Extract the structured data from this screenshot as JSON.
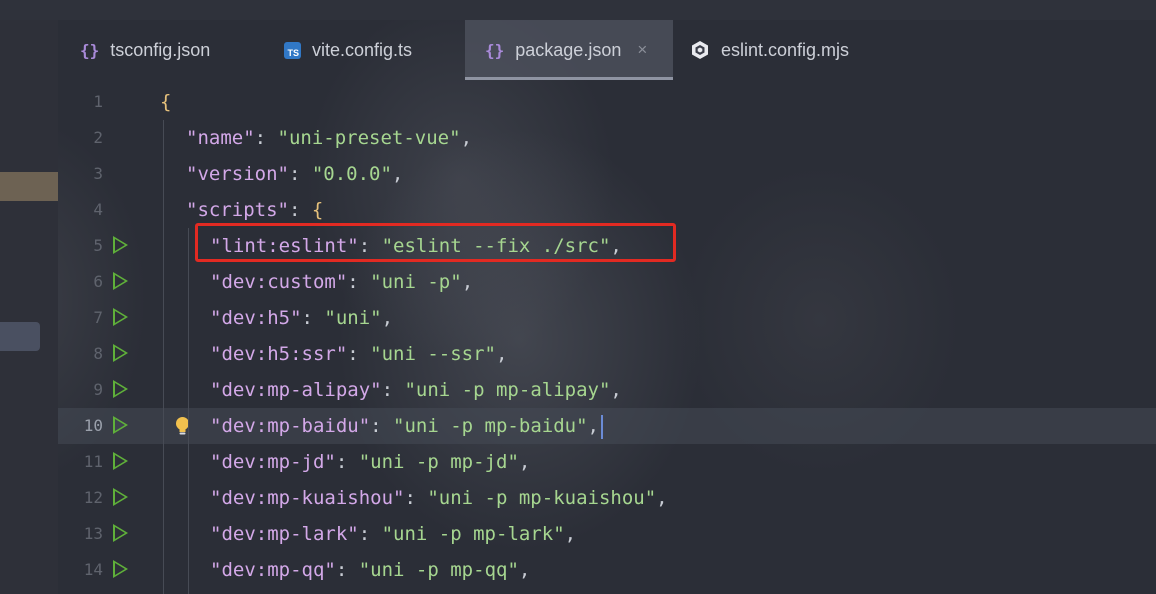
{
  "tabs": [
    {
      "label": "tsconfig.json",
      "icon": "json-brace-icon",
      "active": false
    },
    {
      "label": "vite.config.ts",
      "icon": "typescript-icon",
      "icon_text": "TS",
      "active": false
    },
    {
      "label": "package.json",
      "icon": "json-brace-icon",
      "active": true,
      "close": "×"
    },
    {
      "label": "eslint.config.mjs",
      "icon": "eslint-icon",
      "active": false
    }
  ],
  "editor": {
    "current_line": 10,
    "lines": [
      {
        "n": "1",
        "brace": "{"
      },
      {
        "n": "2",
        "key": "\"name\"",
        "value": "\"uni-preset-vue\"",
        "tail": ","
      },
      {
        "n": "3",
        "key": "\"version\"",
        "value": "\"0.0.0\"",
        "tail": ","
      },
      {
        "n": "4",
        "key": "\"scripts\"",
        "brace": "{"
      },
      {
        "n": "5",
        "key": "\"lint:eslint\"",
        "value": "\"eslint --fix ./src\"",
        "tail": ",",
        "run": true,
        "highlighted": true
      },
      {
        "n": "6",
        "key": "\"dev:custom\"",
        "value": "\"uni -p\"",
        "tail": ",",
        "run": true
      },
      {
        "n": "7",
        "key": "\"dev:h5\"",
        "value": "\"uni\"",
        "tail": ",",
        "run": true
      },
      {
        "n": "8",
        "key": "\"dev:h5:ssr\"",
        "value": "\"uni --ssr\"",
        "tail": ",",
        "run": true
      },
      {
        "n": "9",
        "key": "\"dev:mp-alipay\"",
        "value": "\"uni -p mp-alipay\"",
        "tail": ",",
        "run": true
      },
      {
        "n": "10",
        "key": "\"dev:mp-baidu\"",
        "value": "\"uni -p mp-baidu\"",
        "tail": ",",
        "run": true,
        "bulb": true
      },
      {
        "n": "11",
        "key": "\"dev:mp-jd\"",
        "value": "\"uni -p mp-jd\"",
        "tail": ",",
        "run": true
      },
      {
        "n": "12",
        "key": "\"dev:mp-kuaishou\"",
        "value": "\"uni -p mp-kuaishou\"",
        "tail": ",",
        "run": true
      },
      {
        "n": "13",
        "key": "\"dev:mp-lark\"",
        "value": "\"uni -p mp-lark\"",
        "tail": ",",
        "run": true
      },
      {
        "n": "14",
        "key": "\"dev:mp-qq\"",
        "value": "\"uni -p mp-qq\"",
        "tail": ",",
        "run": true
      }
    ]
  },
  "colors": {
    "key": "#d3a8e8",
    "string": "#a6d690",
    "brace": "#e5c07b",
    "run": "#5fb03a",
    "highlight_box": "#e22a22",
    "ts_icon": "#3178c6"
  }
}
